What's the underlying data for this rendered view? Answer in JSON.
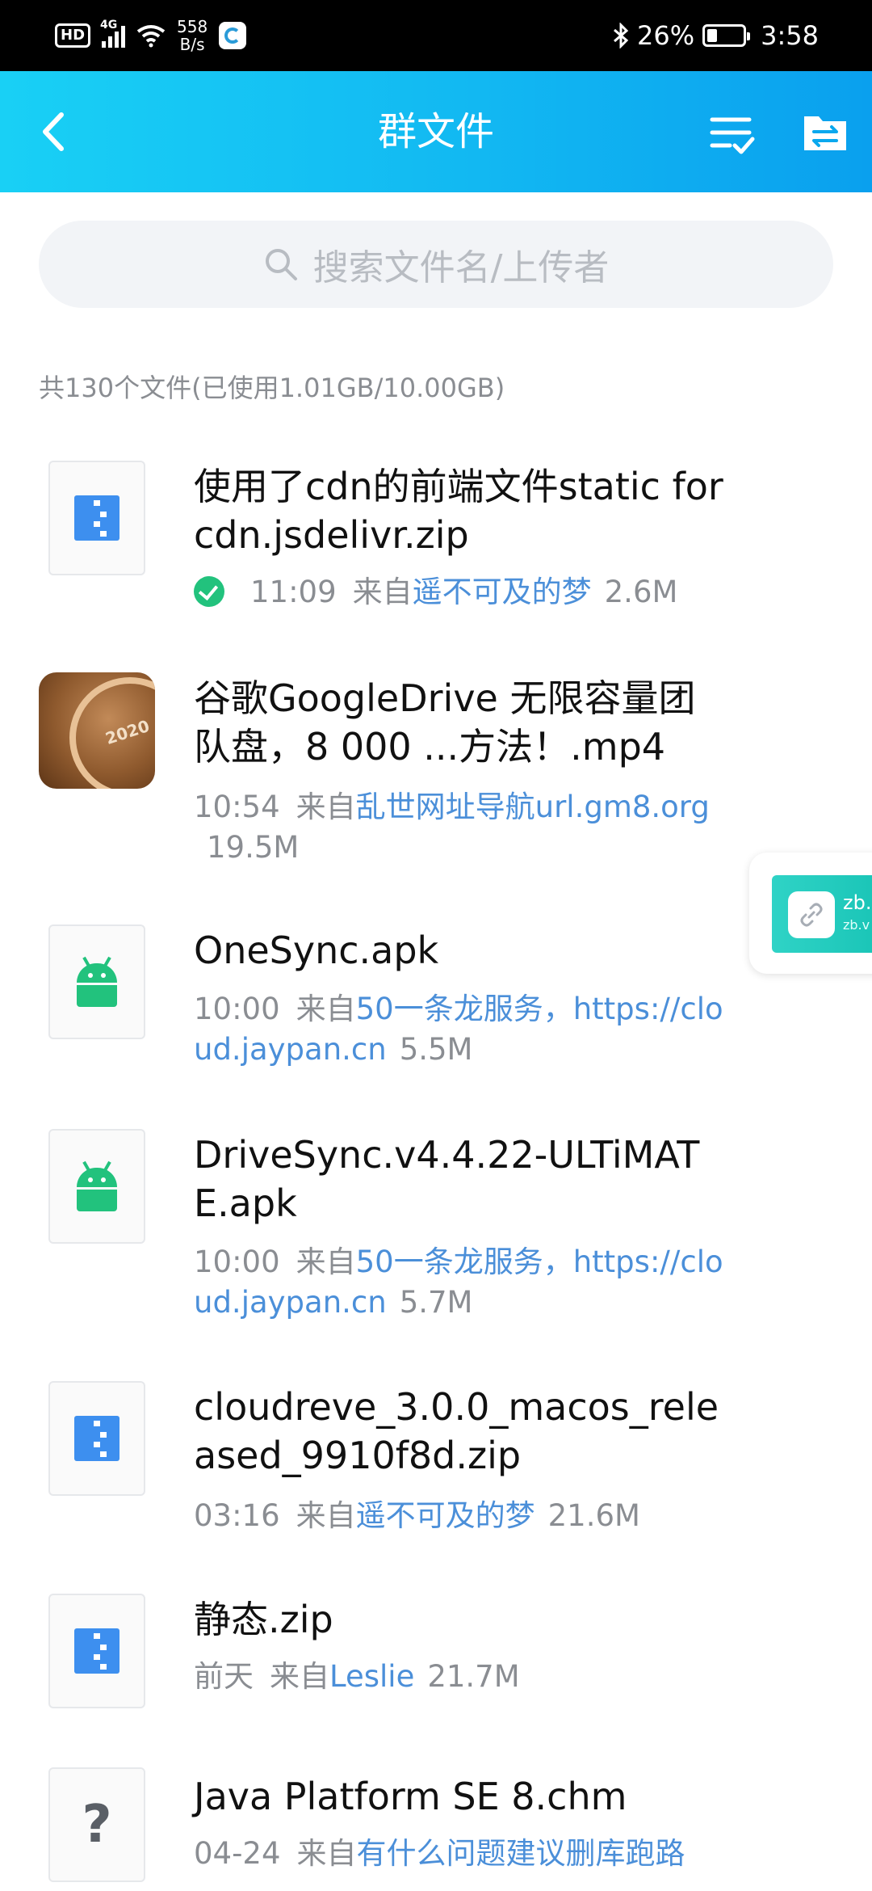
{
  "status_bar": {
    "hd": "HD",
    "network": "4G",
    "speed_value": "558",
    "speed_unit": "B/s",
    "battery": "26%",
    "time": "3:58"
  },
  "header": {
    "title": "群文件"
  },
  "search": {
    "placeholder": "搜索文件名/上传者"
  },
  "summary": "共130个文件(已使用1.01GB/10.00GB)",
  "files": [
    {
      "name": "使用了cdn的前端文件static for cdn.jsdelivr.zip",
      "time": "11:09",
      "from": "来自",
      "uploader": "遥不可及的梦",
      "size": "2.6M",
      "icon": "zip-icon",
      "downloaded": true
    },
    {
      "name": "谷歌GoogleDrive 无限容量团队盘，8 000 ...方法！.mp4",
      "time": "10:54",
      "from": "来自",
      "uploader": "乱世网址导航url.gm8.org",
      "size": "19.5M",
      "icon": "video-thumbnail"
    },
    {
      "name": "OneSync.apk",
      "time": "10:00",
      "from": "来自",
      "uploader": "50一条龙服务，https://cloud.jaypan.cn",
      "size": "5.5M",
      "icon": "android-icon"
    },
    {
      "name": "DriveSync.v4.4.22-ULTiMATE.apk",
      "time": "10:00",
      "from": "来自",
      "uploader": "50一条龙服务，https://cloud.jaypan.cn",
      "size": "5.7M",
      "icon": "android-icon"
    },
    {
      "name": "cloudreve_3.0.0_macos_released_9910f8d.zip",
      "time": "03:16",
      "from": "来自",
      "uploader": "遥不可及的梦",
      "size": "21.6M",
      "icon": "zip-icon"
    },
    {
      "name": "静态.zip",
      "time": "前天",
      "from": "来自",
      "uploader": "Leslie",
      "size": "21.7M",
      "icon": "zip-icon"
    },
    {
      "name": "Java Platform SE 8.chm",
      "time": "04-24",
      "from": "来自",
      "uploader": "有什么问题建议删库跑路",
      "size": "",
      "icon": "unknown-file-icon"
    }
  ],
  "video_thumb_text": "2020",
  "float_widget": {
    "line1": "zb.v",
    "line2": "zb.v"
  },
  "colors": {
    "header_gradient_start": "#19d0f5",
    "header_gradient_end": "#0aa0ee",
    "uploader_link": "#4b8fd9",
    "apk_green": "#22c27d",
    "zip_blue": "#3d8fef"
  }
}
